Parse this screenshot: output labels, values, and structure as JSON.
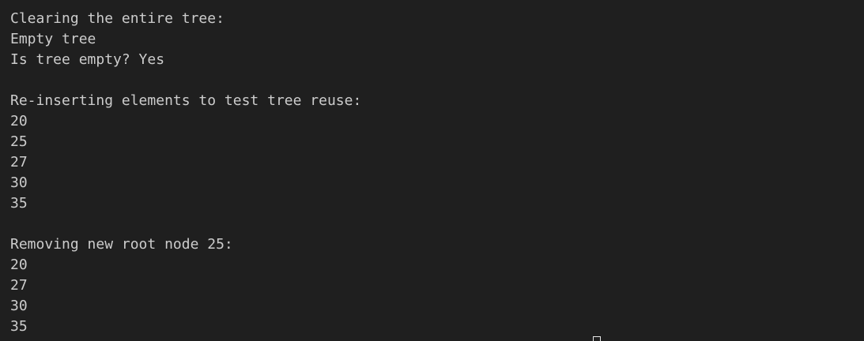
{
  "terminal": {
    "lines": [
      "Clearing the entire tree:",
      "Empty tree",
      "Is tree empty? Yes",
      "",
      "Re-inserting elements to test tree reuse:",
      "20",
      "25",
      "27",
      "30",
      "35",
      "",
      "Removing new root node 25:",
      "20",
      "27",
      "30",
      "35"
    ],
    "colors": {
      "background": "#1f1f1f",
      "text": "#cccccc",
      "cursor": "#e6e6e6"
    }
  }
}
